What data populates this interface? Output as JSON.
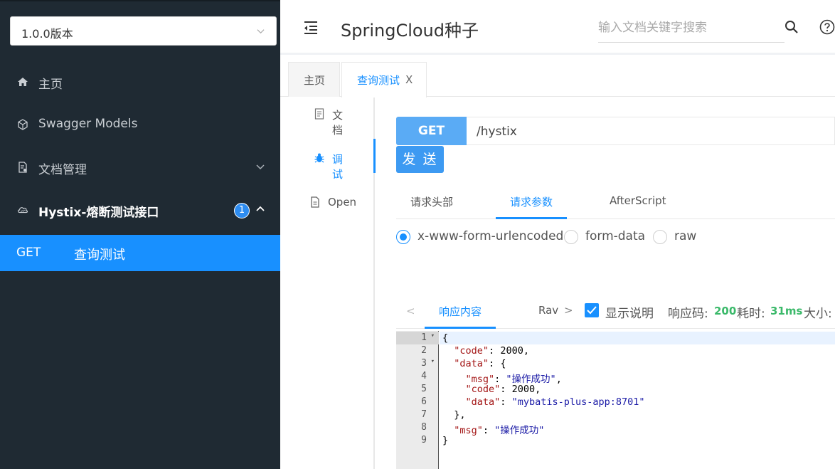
{
  "sidebar": {
    "version_select": "1.0.0版本",
    "items": [
      {
        "label": "主页"
      },
      {
        "label": "Swagger Models"
      },
      {
        "label": "文档管理"
      },
      {
        "label": "Hystix-熔断测试接口",
        "badge": "1"
      }
    ],
    "active_endpoint": {
      "method": "GET",
      "name": "查询测试"
    }
  },
  "header": {
    "title": "SpringCloud种子",
    "search_placeholder": "输入文档关键字搜索"
  },
  "tabs": [
    {
      "label": "主页"
    },
    {
      "label": "查询测试",
      "close": "X"
    }
  ],
  "inner_menu": [
    {
      "label": "文档"
    },
    {
      "label": "调试"
    },
    {
      "label": "Open"
    }
  ],
  "request": {
    "method": "GET",
    "url": "/hystix",
    "send_label": "发 送",
    "sub_tabs": [
      "请求头部",
      "请求参数",
      "AfterScript"
    ],
    "body_types": [
      "x-www-form-urlencoded",
      "form-data",
      "raw"
    ],
    "selected_body_type": "x-www-form-urlencoded"
  },
  "response": {
    "prev_arrow": "<",
    "tabs": [
      "响应内容",
      "Rav"
    ],
    "next_arrow": ">",
    "show_desc_label": "显示说明",
    "show_desc_checked": true,
    "status_label": "响应码:",
    "status_value": "200",
    "time_label": "耗时:",
    "time_value": "31ms",
    "size_label": "大小:",
    "line_numbers": [
      "1",
      "2",
      "3",
      "4",
      "5",
      "6",
      "7",
      "8",
      "9"
    ],
    "fold_marker": "▾",
    "code": {
      "open_brace": "{",
      "close_brace": "}",
      "inner_open": "{",
      "inner_close": "},",
      "k_code": "\"code\"",
      "v_code": "2000",
      "k_data": "\"data\"",
      "k_msg": "\"msg\"",
      "v_msg": "\"操作成功\"",
      "v_data": "\"mybatis-plus-app:8701\""
    },
    "accent_color": "#1890ff",
    "success_color": "#3bb96a"
  }
}
